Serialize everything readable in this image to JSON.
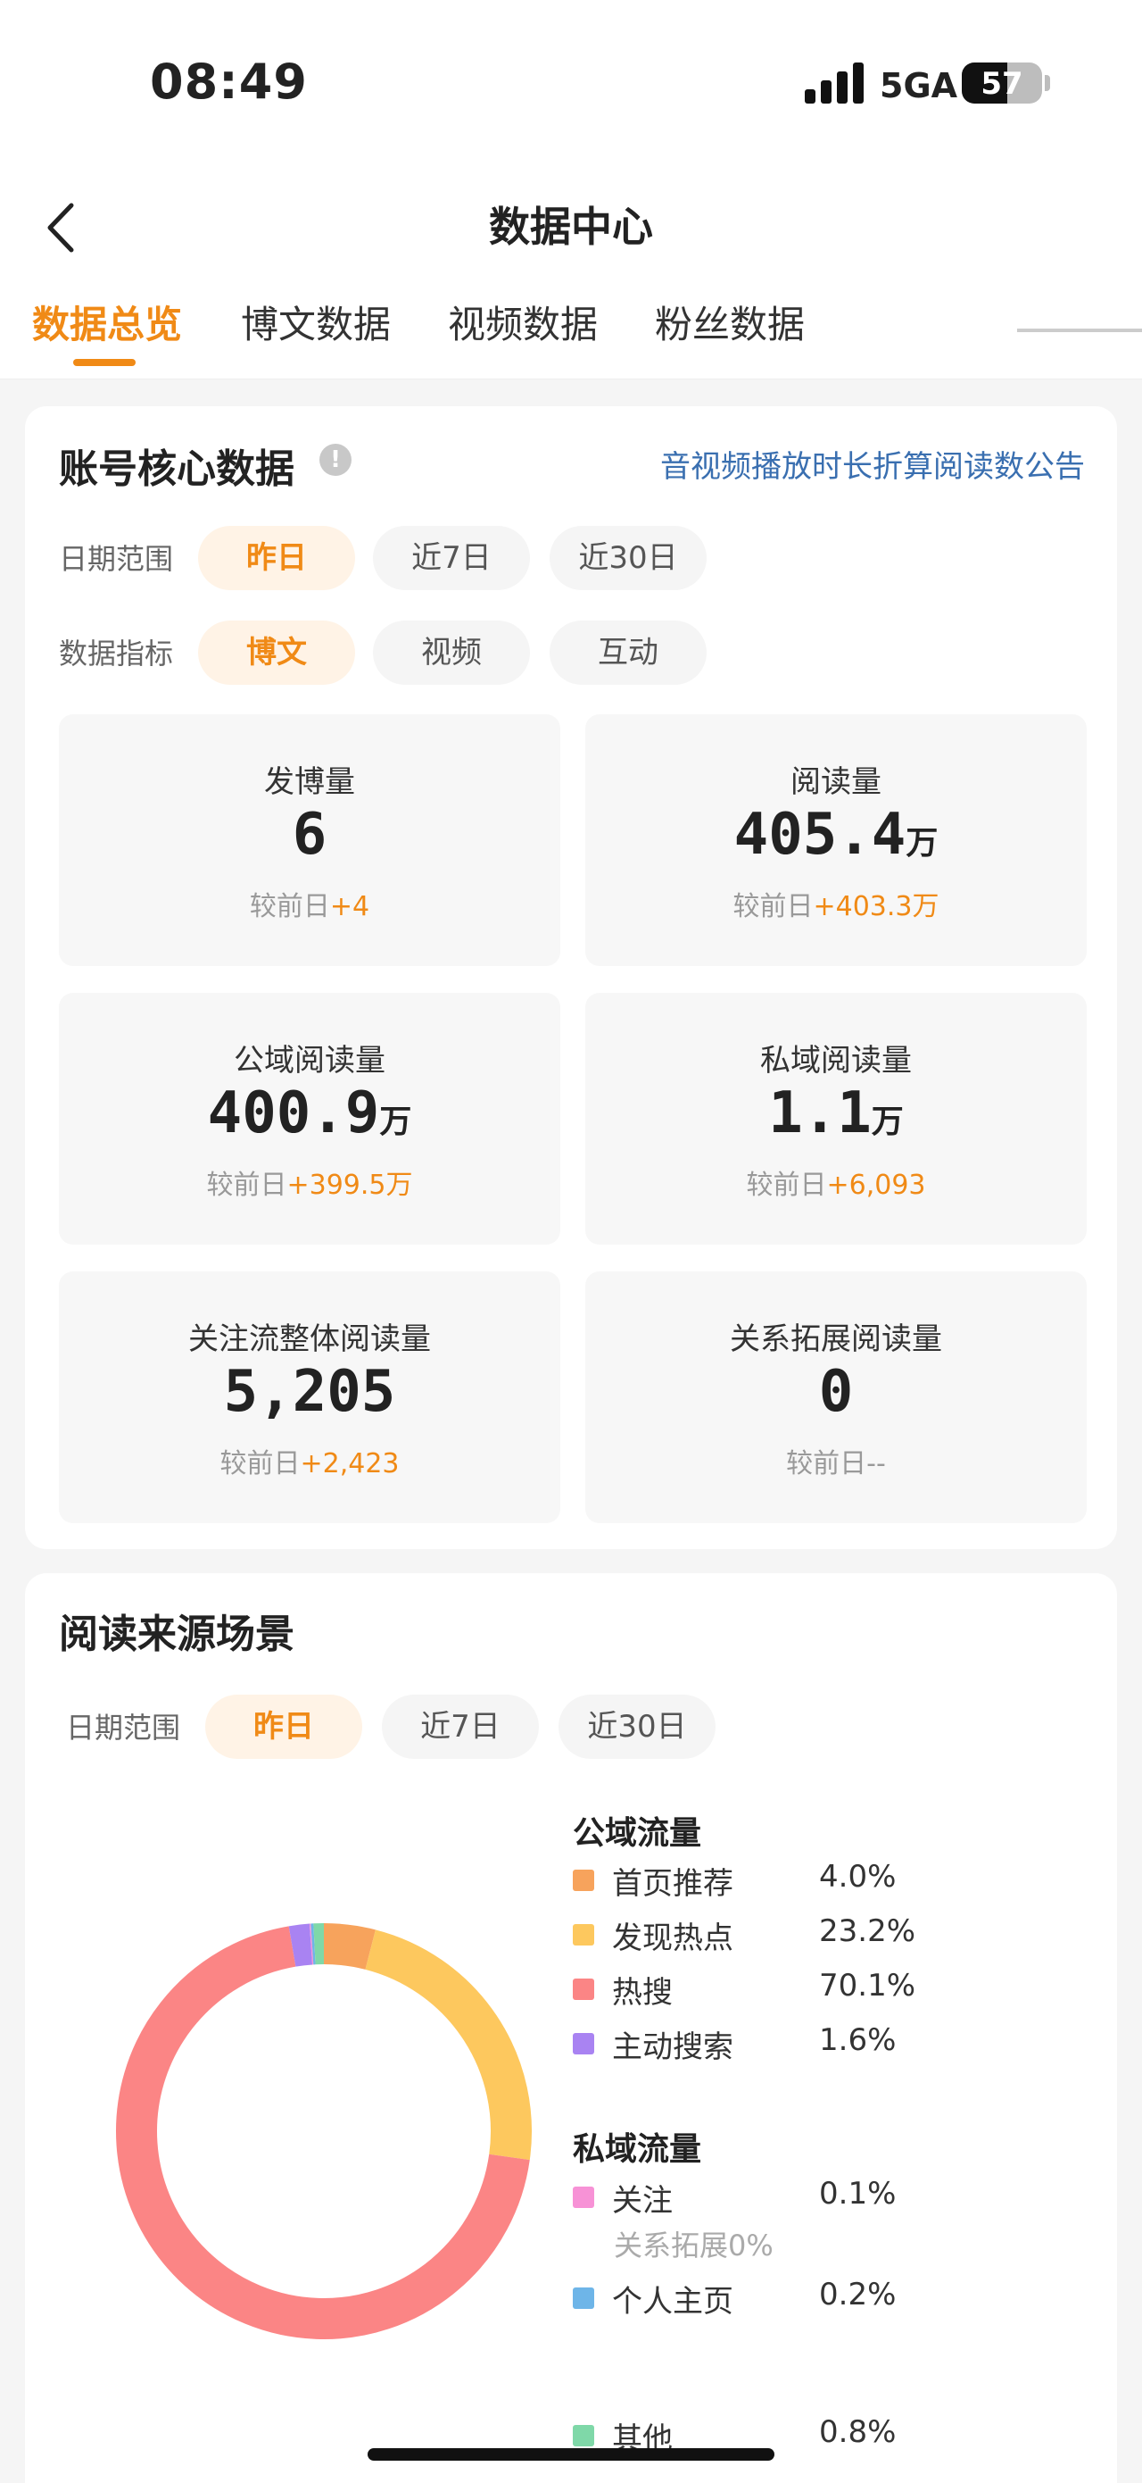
{
  "status_bar": {
    "time": "08:49",
    "network": "5GA",
    "battery": "57",
    "battery_level": 0.57
  },
  "nav": {
    "title": "数据中心"
  },
  "tabs": [
    {
      "label": "数据总览",
      "active": true
    },
    {
      "label": "博文数据",
      "active": false
    },
    {
      "label": "视频数据",
      "active": false
    },
    {
      "label": "粉丝数据",
      "active": false
    }
  ],
  "core": {
    "title": "账号核心数据",
    "info_icon": "!",
    "notice_link": "音视频播放时长折算阅读数公告",
    "date_label": "日期范围",
    "date_options": [
      "昨日",
      "近7日",
      "近30日"
    ],
    "metric_label": "数据指标",
    "metric_options": [
      "博文",
      "视频",
      "互动"
    ],
    "metrics": [
      {
        "label": "发博量",
        "value": "6",
        "unit": "",
        "change_prefix": "较前日",
        "change": "+4"
      },
      {
        "label": "阅读量",
        "value": "405.4",
        "unit": "万",
        "change_prefix": "较前日",
        "change": "+403.3万"
      },
      {
        "label": "公域阅读量",
        "value": "400.9",
        "unit": "万",
        "change_prefix": "较前日",
        "change": "+399.5万"
      },
      {
        "label": "私域阅读量",
        "value": "1.1",
        "unit": "万",
        "change_prefix": "较前日",
        "change": "+6,093"
      },
      {
        "label": "关注流整体阅读量",
        "value": "5,205",
        "unit": "",
        "change_prefix": "较前日",
        "change": "+2,423"
      },
      {
        "label": "关系拓展阅读量",
        "value": "0",
        "unit": "",
        "change_prefix": "较前日",
        "change": "--"
      }
    ]
  },
  "source": {
    "title": "阅读来源场景",
    "date_label": "日期范围",
    "date_options": [
      "昨日",
      "近7日",
      "近30日"
    ],
    "public_title": "公域流量",
    "private_title": "私域流量",
    "relation_note": "关系拓展0%",
    "items": [
      {
        "name": "首页推荐",
        "percent": "4.0%",
        "color": "#f7a35c"
      },
      {
        "name": "发现热点",
        "percent": "23.2%",
        "color": "#fdc85e"
      },
      {
        "name": "热搜",
        "percent": "70.1%",
        "color": "#fb8585"
      },
      {
        "name": "主动搜索",
        "percent": "1.6%",
        "color": "#a983f2"
      },
      {
        "name": "关注",
        "percent": "0.1%",
        "color": "#f792d6"
      },
      {
        "name": "个人主页",
        "percent": "0.2%",
        "color": "#6eb5e8"
      },
      {
        "name": "其他",
        "percent": "0.8%",
        "color": "#7fd8a8"
      }
    ]
  },
  "chart_data": {
    "type": "pie",
    "categories": [
      "首页推荐",
      "发现热点",
      "热搜",
      "主动搜索",
      "关注",
      "个人主页",
      "其他"
    ],
    "values": [
      4.0,
      23.2,
      70.1,
      1.6,
      0.1,
      0.2,
      0.8
    ],
    "colors": [
      "#f7a35c",
      "#fdc85e",
      "#fb8585",
      "#a983f2",
      "#f792d6",
      "#6eb5e8",
      "#7fd8a8"
    ],
    "donut": true,
    "legend": "right"
  }
}
